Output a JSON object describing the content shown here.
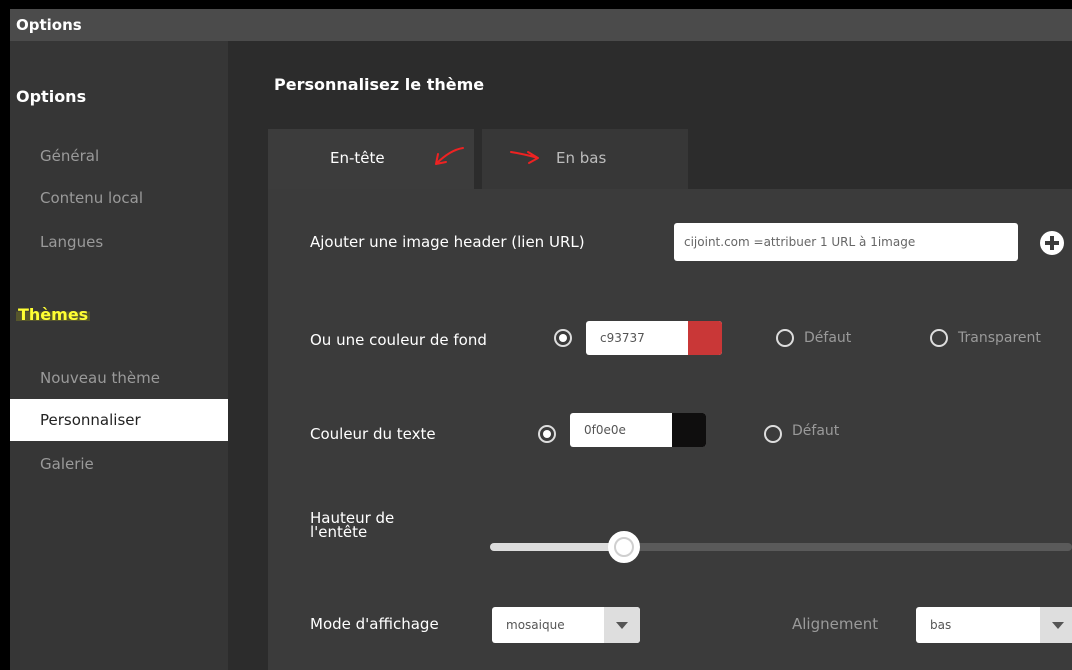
{
  "window": {
    "title": "Options"
  },
  "sidebar": {
    "section_options": "Options",
    "options_items": [
      {
        "label": "Général"
      },
      {
        "label": "Contenu local"
      },
      {
        "label": "Langues"
      }
    ],
    "section_themes": "Thèmes",
    "theme_items": [
      {
        "label": "Nouveau thème"
      },
      {
        "label": "Personnaliser",
        "active": true
      },
      {
        "label": "Galerie"
      }
    ]
  },
  "main": {
    "title": "Personnalisez le thème",
    "tabs": [
      {
        "label": "En-tête",
        "active": true
      },
      {
        "label": "En bas"
      }
    ],
    "annotation_color": "#ee2222",
    "header_image": {
      "label": "Ajouter une image header (lien URL)",
      "placeholder": "cijoint.com =attribuer 1 URL à 1image"
    },
    "background_color": {
      "label": "Ou une couleur de fond",
      "hex": "c93737",
      "swatch": "#c93737",
      "option_default": "Défaut",
      "option_transparent": "Transparent"
    },
    "text_color": {
      "label": "Couleur du texte",
      "hex": "0f0e0e",
      "swatch": "#0f0e0e",
      "option_default": "Défaut"
    },
    "header_height": {
      "label_line1": "Hauteur de",
      "label_line2": "l'entête",
      "value_fraction": 0.23
    },
    "display_mode": {
      "label": "Mode d'affichage",
      "value": "mosaique"
    },
    "alignment": {
      "label": "Alignement",
      "value": "bas"
    }
  }
}
